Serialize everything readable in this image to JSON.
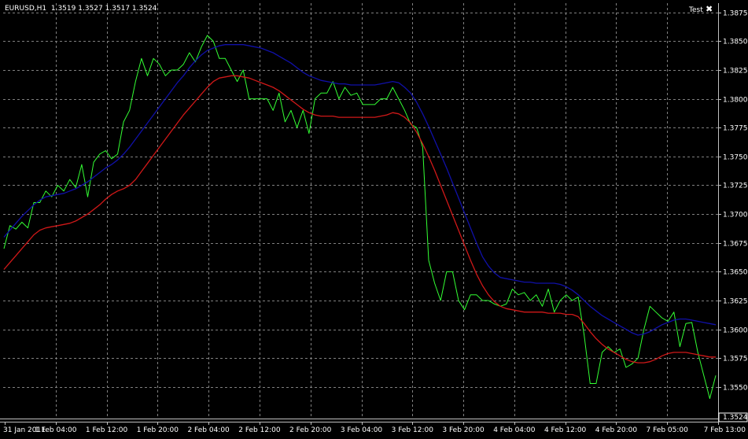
{
  "header": {
    "symbol_timeframe": "EURUSD,H1",
    "ohlc": "1.3519 1.3527 1.3517 1.3524",
    "indicator_label": "Test",
    "close_glyph": "✖"
  },
  "colors": {
    "background": "#000000",
    "grid": "#808080",
    "axis": "#c0c0c0",
    "price": "#33ff33",
    "ma_fast": "#1010a8",
    "ma_slow": "#d01818",
    "text": "#ffffff"
  },
  "chart_data": {
    "type": "line",
    "x_tick_labels": [
      "31 Jan 2011",
      "1 Feb 04:00",
      "1 Feb 12:00",
      "1 Feb 20:00",
      "2 Feb 04:00",
      "2 Feb 12:00",
      "2 Feb 20:00",
      "3 Feb 04:00",
      "3 Feb 12:00",
      "3 Feb 20:00",
      "4 Feb 04:00",
      "4 Feb 12:00",
      "4 Feb 20:00",
      "7 Feb 05:00",
      "7 Feb 13:00"
    ],
    "y_ticks": [
      "1.3875",
      "1.3850",
      "1.3825",
      "1.3800",
      "1.3775",
      "1.3750",
      "1.3725",
      "1.3700",
      "1.3675",
      "1.3650",
      "1.3625",
      "1.3600",
      "1.3575",
      "1.3550"
    ],
    "ylim": [
      1.3524,
      1.3883
    ],
    "current_price": "1.3524",
    "grid": true,
    "series": [
      {
        "color": "#33ff33",
        "values": [
          1.367,
          1.369,
          1.3687,
          1.3693,
          1.3688,
          1.371,
          1.371,
          1.372,
          1.3715,
          1.3725,
          1.372,
          1.373,
          1.3723,
          1.3743,
          1.3715,
          1.3745,
          1.3752,
          1.3755,
          1.3748,
          1.3752,
          1.378,
          1.379,
          1.3815,
          1.3835,
          1.382,
          1.3835,
          1.383,
          1.382,
          1.3825,
          1.3825,
          1.383,
          1.384,
          1.3832,
          1.3845,
          1.3855,
          1.385,
          1.3835,
          1.3835,
          1.3825,
          1.3815,
          1.3825,
          1.38,
          1.38,
          1.38,
          1.38,
          1.379,
          1.3805,
          1.378,
          1.379,
          1.3775,
          1.379,
          1.377,
          1.38,
          1.3805,
          1.3805,
          1.3815,
          1.38,
          1.381,
          1.3803,
          1.3805,
          1.3795,
          1.3795,
          1.3795,
          1.38,
          1.38,
          1.381,
          1.38,
          1.379,
          1.3778,
          1.3775,
          1.3758,
          1.366,
          1.364,
          1.3625,
          1.365,
          1.365,
          1.3625,
          1.3617,
          1.363,
          1.363,
          1.3625,
          1.3625,
          1.3622,
          1.362,
          1.3622,
          1.3635,
          1.363,
          1.3632,
          1.3625,
          1.363,
          1.362,
          1.3635,
          1.3615,
          1.3625,
          1.363,
          1.3625,
          1.3628,
          1.3595,
          1.3553,
          1.3553,
          1.358,
          1.3585,
          1.358,
          1.3583,
          1.3567,
          1.357,
          1.3575,
          1.36,
          1.362,
          1.3615,
          1.361,
          1.3607,
          1.3615,
          1.3585,
          1.3605,
          1.3606,
          1.358,
          1.356,
          1.354,
          1.356
        ]
      },
      {
        "color": "#1010a8",
        "values": [
          1.368,
          1.3686,
          1.3692,
          1.3698,
          1.3703,
          1.3708,
          1.3712,
          1.3715,
          1.3716,
          1.3717,
          1.3718,
          1.372,
          1.3722,
          1.3725,
          1.3728,
          1.3732,
          1.3736,
          1.374,
          1.3743,
          1.3747,
          1.3752,
          1.3758,
          1.3765,
          1.3772,
          1.3779,
          1.3786,
          1.3793,
          1.38,
          1.3807,
          1.3814,
          1.382,
          1.3827,
          1.3833,
          1.3838,
          1.3842,
          1.3844,
          1.3846,
          1.3847,
          1.3847,
          1.3847,
          1.3847,
          1.3846,
          1.3845,
          1.3844,
          1.3842,
          1.384,
          1.3837,
          1.3834,
          1.3831,
          1.3827,
          1.3823,
          1.382,
          1.3818,
          1.3816,
          1.3815,
          1.3814,
          1.3813,
          1.3813,
          1.3812,
          1.3812,
          1.3812,
          1.3812,
          1.3812,
          1.3813,
          1.3814,
          1.3815,
          1.3814,
          1.381,
          1.3805,
          1.3797,
          1.3787,
          1.3776,
          1.3764,
          1.3752,
          1.374,
          1.3727,
          1.3714,
          1.3701,
          1.3688,
          1.3675,
          1.3663,
          1.3655,
          1.3649,
          1.3645,
          1.3644,
          1.3643,
          1.3642,
          1.3641,
          1.3641,
          1.364,
          1.364,
          1.364,
          1.364,
          1.3639,
          1.3637,
          1.3634,
          1.363,
          1.3625,
          1.362,
          1.3616,
          1.3612,
          1.3609,
          1.3606,
          1.3603,
          1.36,
          1.3597,
          1.3595,
          1.3596,
          1.3598,
          1.3601,
          1.3604,
          1.3606,
          1.3608,
          1.3609,
          1.3609,
          1.3608,
          1.3607,
          1.3606,
          1.3605,
          1.3604
        ]
      },
      {
        "color": "#d01818",
        "values": [
          1.3652,
          1.3658,
          1.3664,
          1.367,
          1.3676,
          1.3682,
          1.3686,
          1.3688,
          1.3689,
          1.369,
          1.3691,
          1.3692,
          1.3694,
          1.3697,
          1.37,
          1.3704,
          1.3708,
          1.3713,
          1.3717,
          1.372,
          1.3722,
          1.3725,
          1.373,
          1.3737,
          1.3744,
          1.3751,
          1.3758,
          1.3765,
          1.3772,
          1.3779,
          1.3786,
          1.3792,
          1.3798,
          1.3804,
          1.381,
          1.3815,
          1.3818,
          1.3819,
          1.382,
          1.382,
          1.3819,
          1.3818,
          1.3816,
          1.3814,
          1.3812,
          1.381,
          1.3807,
          1.3803,
          1.3799,
          1.3795,
          1.3791,
          1.3788,
          1.3786,
          1.3785,
          1.3785,
          1.3785,
          1.3784,
          1.3784,
          1.3784,
          1.3784,
          1.3784,
          1.3784,
          1.3784,
          1.3785,
          1.3786,
          1.3788,
          1.3787,
          1.3784,
          1.3779,
          1.3771,
          1.3761,
          1.375,
          1.3738,
          1.3725,
          1.3712,
          1.3699,
          1.3686,
          1.3673,
          1.366,
          1.3648,
          1.3638,
          1.363,
          1.3624,
          1.362,
          1.3618,
          1.3617,
          1.3616,
          1.3615,
          1.3615,
          1.3615,
          1.3615,
          1.3614,
          1.3614,
          1.3614,
          1.3613,
          1.3613,
          1.3611,
          1.3605,
          1.3598,
          1.3592,
          1.3587,
          1.3583,
          1.358,
          1.3577,
          1.3574,
          1.3572,
          1.3571,
          1.3571,
          1.3572,
          1.3574,
          1.3577,
          1.3579,
          1.358,
          1.358,
          1.358,
          1.3579,
          1.3578,
          1.3577,
          1.3576,
          1.3576
        ]
      }
    ]
  }
}
